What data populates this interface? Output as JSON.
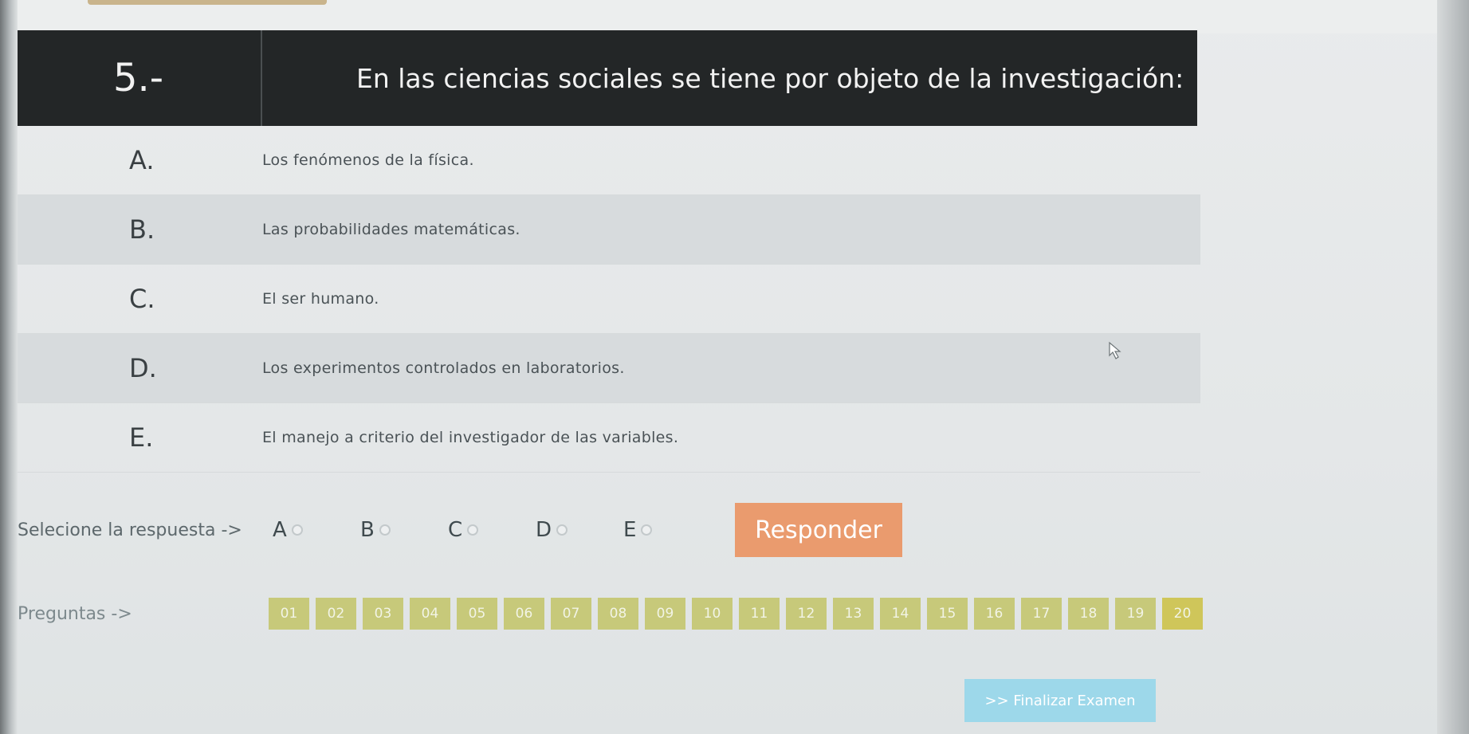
{
  "question": {
    "number": "5.-",
    "text": "En las ciencias sociales se tiene por objeto de la investigación:"
  },
  "options": [
    {
      "letter": "A.",
      "text": "Los fenómenos de la física."
    },
    {
      "letter": "B.",
      "text": "Las probabilidades matemáticas."
    },
    {
      "letter": "C.",
      "text": "El ser humano."
    },
    {
      "letter": "D.",
      "text": "Los experimentos controlados en laboratorios."
    },
    {
      "letter": "E.",
      "text": "El manejo a criterio del investigador de las variables."
    }
  ],
  "answer": {
    "label": "Selecione la respuesta ->",
    "choices": [
      "A",
      "B",
      "C",
      "D",
      "E"
    ],
    "submit_label": "Responder"
  },
  "navigation": {
    "label": "Preguntas ->",
    "items": [
      "01",
      "02",
      "03",
      "04",
      "05",
      "06",
      "07",
      "08",
      "09",
      "10",
      "11",
      "12",
      "13",
      "14",
      "15",
      "16",
      "17",
      "18",
      "19",
      "20"
    ],
    "finish_label": ">> Finalizar Examen"
  },
  "colors": {
    "header_bg": "#232627",
    "submit_bg": "#ea9b6e",
    "nav_btn_bg": "#c7c97a",
    "finish_bg": "#9dd8ea"
  }
}
